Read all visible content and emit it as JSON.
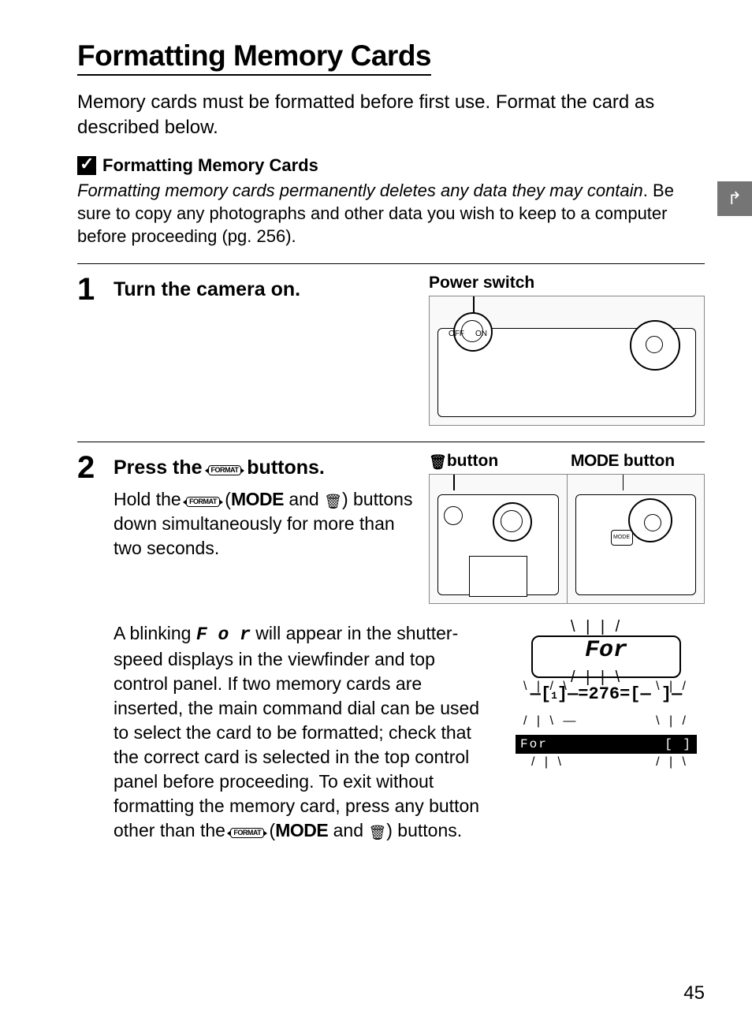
{
  "title": "Formatting Memory Cards",
  "intro": "Memory cards must be formatted before first use.  Format the card as described below.",
  "note": {
    "heading": "Formatting Memory Cards",
    "line1_italic": "Formatting memory cards permanently deletes any data they may contain",
    "line2": ".  Be sure to copy any photographs and other data you wish to keep to a computer before proceeding (pg. 256)."
  },
  "steps": {
    "s1": {
      "num": "1",
      "heading": "Turn the camera on.",
      "fig_label": "Power switch"
    },
    "s2": {
      "num": "2",
      "heading_pre": "Press the ",
      "heading_post": " buttons.",
      "body_pre": "Hold the ",
      "body_mid1": " (",
      "body_mode": "MODE",
      "body_mid2": " and ",
      "body_post": ") buttons down simultaneously for more than two seconds.",
      "fig_label_left": "button",
      "fig_label_right_mode": "MODE",
      "fig_label_right_suffix": " button",
      "para2_pre": "A blinking ",
      "para2_for": "F o r",
      "para2_post": " will appear in the shutter-speed displays in the viewfinder and top control panel.  If two memory cards are inserted, the main command dial can be used to select the card to be formatted; check that the correct card is selected in the top control panel before proceeding.  To exit without formatting the memory card, press any button other than the ",
      "para2_mid1": " (",
      "para2_mode": "MODE",
      "para2_mid2": " and ",
      "para2_end": ") buttons.",
      "lcd": {
        "for_top": "For",
        "mid": "276",
        "bar_left": "For",
        "bar_right": "[  ]"
      }
    }
  },
  "format_icon_text": "FORMAT",
  "page_number": "45"
}
